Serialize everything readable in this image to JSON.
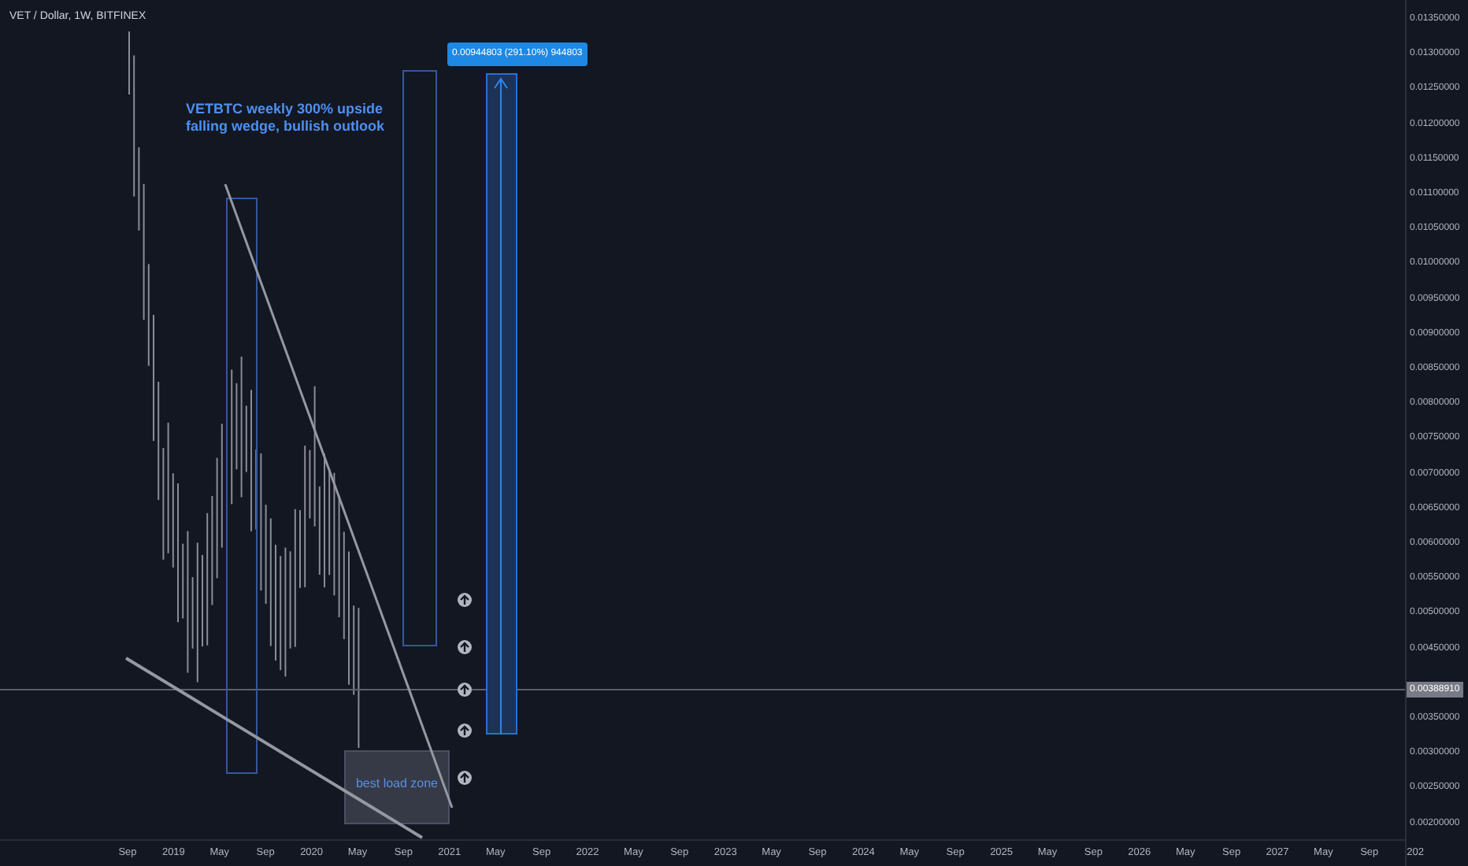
{
  "header": {
    "title": "VET / Dollar, 1W, BITFINEX"
  },
  "note": {
    "lines": [
      "VETBTC weekly 300% upside",
      "falling wedge, bullish outlook"
    ]
  },
  "measure_label": "0.00944803 (291.10%) 944803",
  "zone_label": "best load zone",
  "price_axis": {
    "labels_above": [
      "0.01350000",
      "0.01300000",
      "0.01250000",
      "0.01200000",
      "0.01150000",
      "0.01100000",
      "0.01050000",
      "0.01000000",
      "0.00950000",
      "0.00900000",
      "0.00850000",
      "0.00800000",
      "0.00750000",
      "0.00700000",
      "0.00650000",
      "0.00600000",
      "0.00550000",
      "0.00500000",
      "0.00450000"
    ],
    "labels_below": [
      "0.00350000",
      "0.00300000",
      "0.00250000",
      "0.00200000"
    ],
    "current_price": "0.00388910"
  },
  "time_axis": {
    "labels": [
      "Sep",
      "2019",
      "May",
      "Sep",
      "2020",
      "May",
      "Sep",
      "2021",
      "May",
      "Sep",
      "2022",
      "May",
      "Sep",
      "2023",
      "May",
      "Sep",
      "2024",
      "May",
      "Sep",
      "2025",
      "May",
      "Sep",
      "2026",
      "May",
      "Sep",
      "2027",
      "May",
      "Sep",
      "202"
    ]
  }
}
